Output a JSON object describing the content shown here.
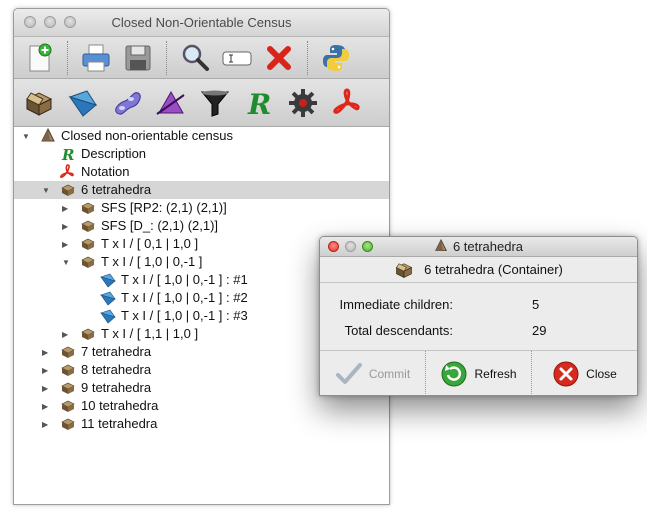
{
  "main_window": {
    "title": "Closed Non-Orientable Census"
  },
  "toolbar1": [
    {
      "name": "new-file-icon"
    },
    {
      "name": "print-icon"
    },
    {
      "name": "save-icon"
    },
    {
      "name": "search-icon"
    },
    {
      "name": "rename-icon"
    },
    {
      "name": "delete-icon"
    },
    {
      "name": "python-icon"
    }
  ],
  "toolbar2": [
    {
      "name": "container-icon"
    },
    {
      "name": "triangulation-icon"
    },
    {
      "name": "surfaces-icon"
    },
    {
      "name": "angle-structures-icon"
    },
    {
      "name": "filter-icon"
    },
    {
      "name": "script-icon"
    },
    {
      "name": "gear-icon"
    },
    {
      "name": "pdf-icon"
    }
  ],
  "tree": [
    {
      "label": "Closed non-orientable census",
      "icon": "census",
      "indent": 0,
      "arrow": "down"
    },
    {
      "label": "Description",
      "icon": "script",
      "indent": 1,
      "arrow": ""
    },
    {
      "label": "Notation",
      "icon": "pdf",
      "indent": 1,
      "arrow": ""
    },
    {
      "label": "6 tetrahedra",
      "icon": "container",
      "indent": 1,
      "arrow": "down",
      "selected": true
    },
    {
      "label": "SFS [RP2: (2,1) (2,1)]",
      "icon": "container",
      "indent": 2,
      "arrow": "right"
    },
    {
      "label": "SFS [D_: (2,1) (2,1)]",
      "icon": "container",
      "indent": 2,
      "arrow": "right"
    },
    {
      "label": "T x I / [ 0,1 | 1,0 ]",
      "icon": "container",
      "indent": 2,
      "arrow": "right"
    },
    {
      "label": "T x I / [ 1,0 | 0,-1 ]",
      "icon": "container",
      "indent": 2,
      "arrow": "down"
    },
    {
      "label": "T x I / [ 1,0 | 0,-1 ] : #1",
      "icon": "tri",
      "indent": 3,
      "arrow": ""
    },
    {
      "label": "T x I / [ 1,0 | 0,-1 ] : #2",
      "icon": "tri",
      "indent": 3,
      "arrow": ""
    },
    {
      "label": "T x I / [ 1,0 | 0,-1 ] : #3",
      "icon": "tri",
      "indent": 3,
      "arrow": ""
    },
    {
      "label": "T x I / [ 1,1 | 1,0 ]",
      "icon": "container",
      "indent": 2,
      "arrow": "right"
    },
    {
      "label": "7 tetrahedra",
      "icon": "container",
      "indent": 1,
      "arrow": "right"
    },
    {
      "label": "8 tetrahedra",
      "icon": "container",
      "indent": 1,
      "arrow": "right"
    },
    {
      "label": "9 tetrahedra",
      "icon": "container",
      "indent": 1,
      "arrow": "right"
    },
    {
      "label": "10 tetrahedra",
      "icon": "container",
      "indent": 1,
      "arrow": "right"
    },
    {
      "label": "11 tetrahedra",
      "icon": "container",
      "indent": 1,
      "arrow": "right"
    }
  ],
  "dialog": {
    "title": "6 tetrahedra",
    "header": "6 tetrahedra (Container)",
    "immediate_children_label": "Immediate children:",
    "immediate_children": "5",
    "total_descendants_label": "Total descendants:",
    "total_descendants": "29",
    "commit_label": "Commit",
    "refresh_label": "Refresh",
    "close_label": "Close"
  }
}
